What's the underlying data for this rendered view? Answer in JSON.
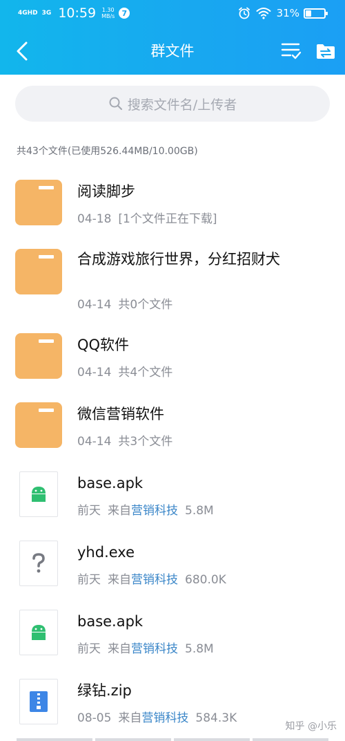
{
  "status_bar": {
    "network_primary": "4GHD",
    "network_secondary": "3G",
    "time": "10:59",
    "speed_value": "1.30",
    "speed_unit": "MB/s",
    "notification_count": "7",
    "battery": "31%",
    "battery_level": 0.31
  },
  "header": {
    "title": "群文件",
    "back_icon": "back-arrow-icon",
    "sort_icon": "list-check-icon",
    "folder_icon": "folder-transfer-icon"
  },
  "search": {
    "placeholder": "搜索文件名/上传者"
  },
  "summary": "共43个文件(已使用526.44MB/10.00GB)",
  "files": [
    {
      "type": "folder",
      "name": "阅读脚步",
      "date": "04-18",
      "info": "[1个文件正在下载]"
    },
    {
      "type": "folder",
      "name": "合成游戏旅行世界，分红招财犬",
      "date": "04-14",
      "info": "共0个文件"
    },
    {
      "type": "folder",
      "name": "QQ软件",
      "date": "04-14",
      "info": "共4个文件"
    },
    {
      "type": "folder",
      "name": "微信营销软件",
      "date": "04-14",
      "info": "共3个文件"
    },
    {
      "type": "apk",
      "name": "base.apk",
      "date": "前天",
      "from_prefix": "来自",
      "source": "营销科技",
      "size": "5.8M"
    },
    {
      "type": "unknown",
      "name": "yhd.exe",
      "date": "前天",
      "from_prefix": "来自",
      "source": "营销科技",
      "size": "680.0K"
    },
    {
      "type": "apk",
      "name": "base.apk",
      "date": "前天",
      "from_prefix": "来自",
      "source": "营销科技",
      "size": "5.8M"
    },
    {
      "type": "zip",
      "name": "绿钻.zip",
      "date": "08-05",
      "from_prefix": "来自",
      "source": "营销科技",
      "size": "584.3K"
    }
  ],
  "watermark": "知乎 @小乐",
  "colors": {
    "header": "#16adef",
    "folder": "#f5b566",
    "apk": "#2fbf71",
    "zip": "#3d86e6",
    "source_link": "#3a86c8"
  }
}
